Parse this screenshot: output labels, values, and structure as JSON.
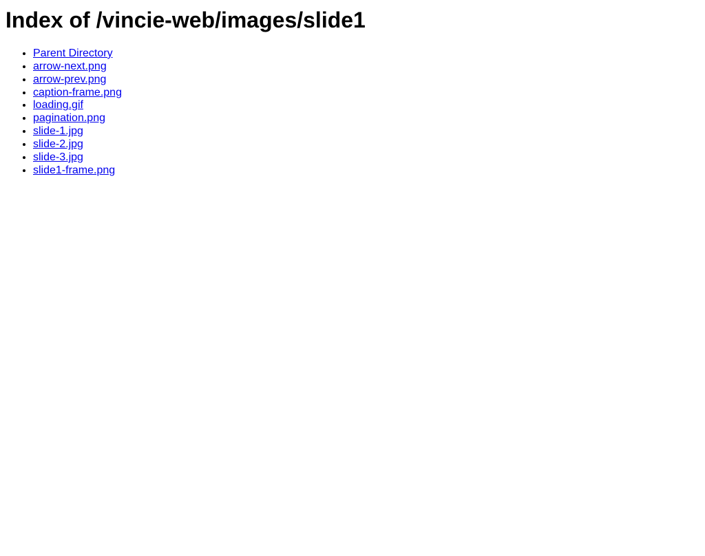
{
  "page": {
    "title": "Index of /vincie-web/images/slide1",
    "background_color": "#ffffff",
    "text_color": "#000000",
    "link_color": "#0000ee",
    "path": "/vincie-web/images/slide1"
  },
  "listing": {
    "items": [
      {
        "label": "Parent Directory",
        "kind": "directory-link"
      },
      {
        "label": "arrow-next.png",
        "kind": "file-link"
      },
      {
        "label": "arrow-prev.png",
        "kind": "file-link"
      },
      {
        "label": "caption-frame.png",
        "kind": "file-link"
      },
      {
        "label": "loading.gif",
        "kind": "file-link"
      },
      {
        "label": "pagination.png",
        "kind": "file-link"
      },
      {
        "label": "slide-1.jpg",
        "kind": "file-link"
      },
      {
        "label": "slide-2.jpg",
        "kind": "file-link"
      },
      {
        "label": "slide-3.jpg",
        "kind": "file-link"
      },
      {
        "label": "slide1-frame.png",
        "kind": "file-link"
      }
    ]
  }
}
